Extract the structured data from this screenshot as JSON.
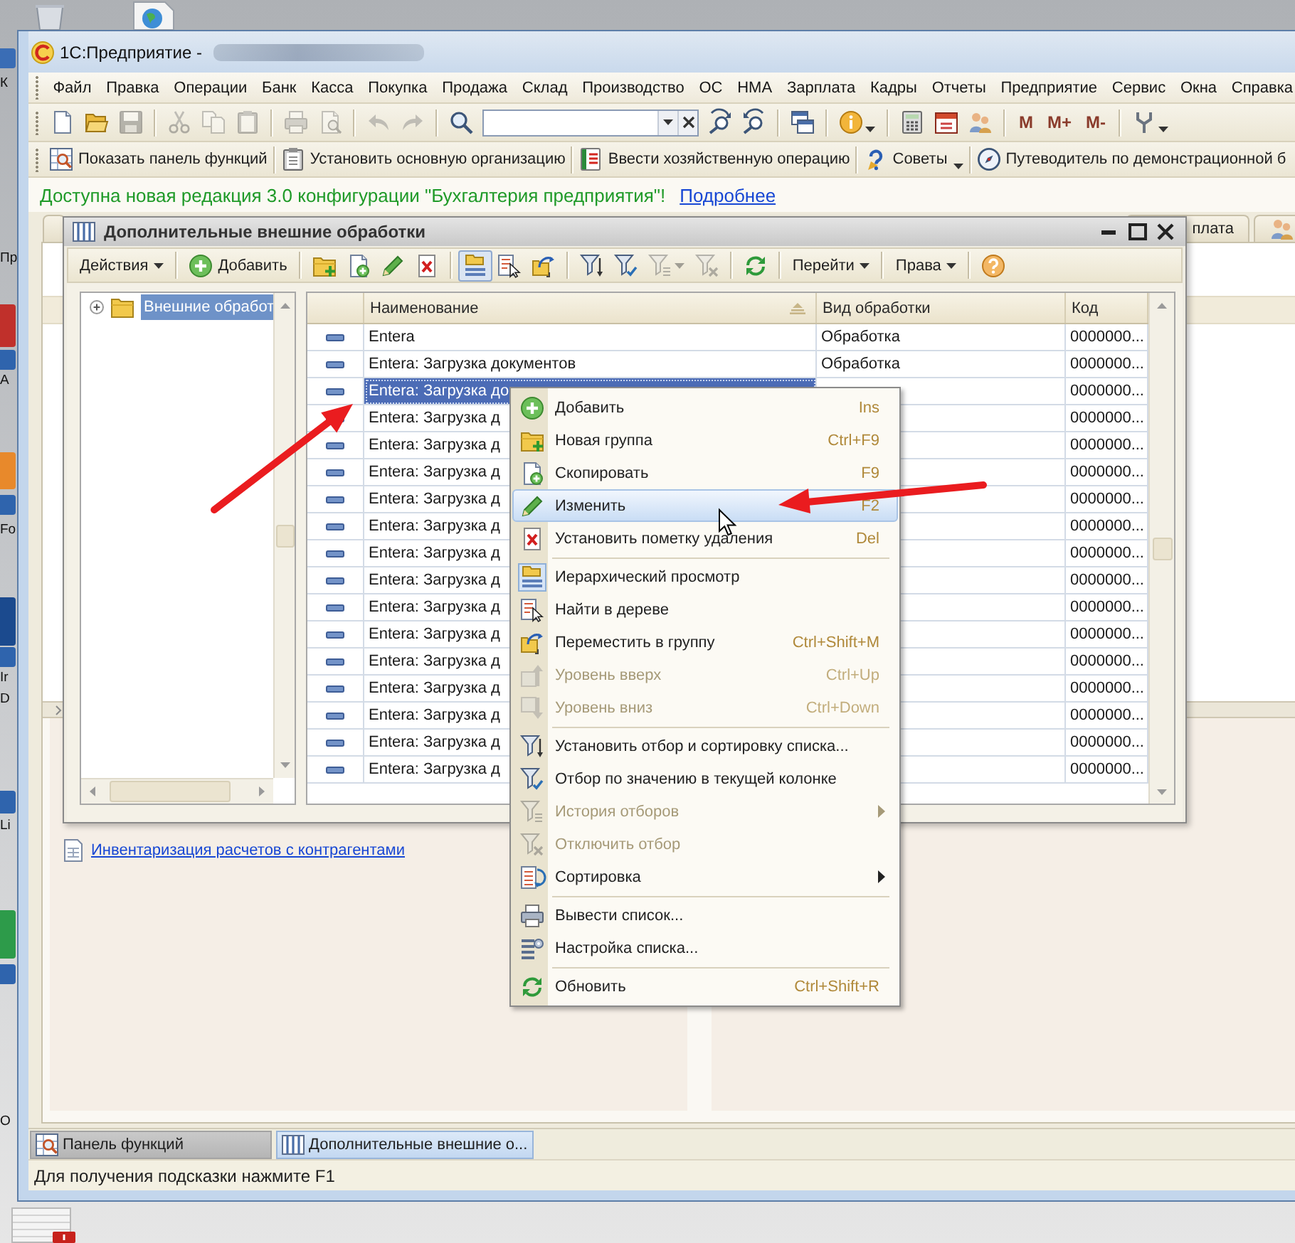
{
  "desktop": {
    "icon_labels": [
      "К",
      "Пр",
      "А",
      "Fo",
      "Ir",
      "D",
      "Li",
      "O"
    ]
  },
  "window": {
    "title": "1С:Предприятие -"
  },
  "menu_bar": [
    "Файл",
    "Правка",
    "Операции",
    "Банк",
    "Касса",
    "Покупка",
    "Продажа",
    "Склад",
    "Производство",
    "ОС",
    "НМА",
    "Зарплата",
    "Кадры",
    "Отчеты",
    "Предприятие",
    "Сервис",
    "Окна",
    "Справка"
  ],
  "toolbar": [
    [
      {
        "kind": "icon",
        "disabled": false,
        "has_menu": false
      },
      {
        "kind": "icon",
        "disabled": false,
        "has_menu": false
      },
      {
        "kind": "icon",
        "disabled": true,
        "has_menu": false
      }
    ],
    [
      {
        "kind": "icon",
        "disabled": true,
        "has_menu": false
      },
      {
        "kind": "icon",
        "disabled": true,
        "has_menu": false
      },
      {
        "kind": "icon",
        "disabled": true,
        "has_menu": false
      }
    ],
    [
      {
        "kind": "icon",
        "disabled": true,
        "has_menu": false
      },
      {
        "kind": "icon",
        "disabled": true,
        "has_menu": false
      }
    ],
    [
      {
        "kind": "icon",
        "disabled": true,
        "has_menu": false
      },
      {
        "kind": "icon",
        "disabled": true,
        "has_menu": false
      }
    ],
    [
      {
        "kind": "icon",
        "disabled": false,
        "has_menu": false
      },
      {
        "kind": "search_field",
        "disabled": false,
        "has_menu": true
      },
      {
        "kind": "icon",
        "disabled": false,
        "has_menu": false
      },
      {
        "kind": "icon",
        "disabled": false,
        "has_menu": false
      }
    ],
    [
      {
        "kind": "icon",
        "disabled": false,
        "has_menu": false
      }
    ],
    [
      {
        "kind": "icon",
        "disabled": false,
        "has_menu": true
      }
    ],
    [
      {
        "kind": "icon",
        "disabled": false,
        "has_menu": false
      },
      {
        "kind": "icon",
        "disabled": false,
        "has_menu": false
      },
      {
        "kind": "icon",
        "disabled": false,
        "has_menu": false
      }
    ],
    [
      {
        "kind": "text",
        "label": "M",
        "disabled": false,
        "has_menu": false
      },
      {
        "kind": "text",
        "label": "M+",
        "disabled": false,
        "has_menu": false
      },
      {
        "kind": "text",
        "label": "M-",
        "disabled": false,
        "has_menu": false
      }
    ],
    [
      {
        "kind": "icon",
        "disabled": false,
        "has_menu": true
      }
    ]
  ],
  "toolbar_2": [
    {
      "label": "Показать панель функций",
      "has_menu": false
    },
    {
      "label": "Установить основную организацию",
      "has_menu": false
    },
    {
      "label": "Ввести хозяйственную операцию",
      "has_menu": false
    },
    {
      "label": "Советы",
      "has_menu": true
    },
    {
      "label": "Путеводитель по демонстрационной б",
      "has_menu": false
    }
  ],
  "notice": {
    "text": "Доступна новая редакция 3.0 конфигурации \"Бухгалтерия предприятия\"!",
    "link": "Подробнее"
  },
  "workspace": {
    "tabs": [
      {
        "kind": "text",
        "label": "плата"
      },
      {
        "kind": "icon"
      }
    ],
    "links": [
      "Инвентаризация расчетов с контрагентами"
    ]
  },
  "dialog": {
    "title": "Дополнительные внешние обработки",
    "toolbar": [
      [
        {
          "kind": "menu",
          "label": "Действия",
          "pressed": false,
          "disabled": false,
          "has_menu": true
        }
      ],
      [
        {
          "kind": "button",
          "label": "Добавить",
          "pressed": false,
          "disabled": false,
          "has_menu": false
        }
      ],
      [
        {
          "kind": "icon",
          "pressed": false,
          "disabled": false,
          "has_menu": false
        },
        {
          "kind": "icon",
          "pressed": false,
          "disabled": false,
          "has_menu": false
        },
        {
          "kind": "icon",
          "pressed": false,
          "disabled": false,
          "has_menu": false
        },
        {
          "kind": "icon",
          "pressed": false,
          "disabled": false,
          "has_menu": false
        }
      ],
      [
        {
          "kind": "icon",
          "pressed": true,
          "disabled": false,
          "has_menu": false
        },
        {
          "kind": "icon",
          "pressed": false,
          "disabled": false,
          "has_menu": false
        },
        {
          "kind": "icon",
          "pressed": false,
          "disabled": false,
          "has_menu": false
        }
      ],
      [
        {
          "kind": "icon",
          "pressed": false,
          "disabled": false,
          "has_menu": false
        },
        {
          "kind": "icon",
          "pressed": false,
          "disabled": false,
          "has_menu": false
        },
        {
          "kind": "icon",
          "pressed": false,
          "disabled": true,
          "has_menu": true
        },
        {
          "kind": "icon",
          "pressed": false,
          "disabled": true,
          "has_menu": false
        }
      ],
      [
        {
          "kind": "icon",
          "pressed": false,
          "disabled": false,
          "has_menu": false
        }
      ],
      [
        {
          "kind": "menu",
          "label": "Перейти",
          "pressed": false,
          "disabled": false,
          "has_menu": true
        }
      ],
      [
        {
          "kind": "menu",
          "label": "Права",
          "pressed": false,
          "disabled": false,
          "has_menu": true
        }
      ],
      [
        {
          "kind": "icon",
          "pressed": false,
          "disabled": false,
          "has_menu": false
        }
      ]
    ],
    "tree": [
      {
        "label": "Внешние обработ",
        "selected": true,
        "expanded": false
      }
    ],
    "table": {
      "columns": [
        {
          "label": "Наименование",
          "sorted": true
        },
        {
          "label": "Вид обработки",
          "sorted": false
        },
        {
          "label": "Код",
          "sorted": false
        }
      ],
      "rows": [
        {
          "name": "Entera",
          "type": "Обработка",
          "code": "0000000...",
          "selected": false
        },
        {
          "name": "Entera: Загрузка документов",
          "type": "Обработка",
          "code": "0000000...",
          "selected": false
        },
        {
          "name": "Entera: Загрузка до",
          "code": "0000000...",
          "selected": true
        },
        {
          "name": "Entera: Загрузка д",
          "code": "0000000...",
          "selected": false
        },
        {
          "name": "Entera: Загрузка д",
          "code": "0000000...",
          "selected": false
        },
        {
          "name": "Entera: Загрузка д",
          "code": "0000000...",
          "selected": false
        },
        {
          "name": "Entera: Загрузка д",
          "code": "0000000...",
          "selected": false
        },
        {
          "name": "Entera: Загрузка д",
          "code": "0000000...",
          "selected": false
        },
        {
          "name": "Entera: Загрузка д",
          "code": "0000000...",
          "selected": false
        },
        {
          "name": "Entera: Загрузка д",
          "code": "0000000...",
          "selected": false
        },
        {
          "name": "Entera: Загрузка д",
          "code": "0000000...",
          "selected": false
        },
        {
          "name": "Entera: Загрузка д",
          "code": "0000000...",
          "selected": false
        },
        {
          "name": "Entera: Загрузка д",
          "code": "0000000...",
          "selected": false
        },
        {
          "name": "Entera: Загрузка д",
          "code": "0000000...",
          "selected": false
        },
        {
          "name": "Entera: Загрузка д",
          "code": "0000000...",
          "selected": false
        },
        {
          "name": "Entera: Загрузка д",
          "code": "0000000...",
          "selected": false
        },
        {
          "name": "Entera: Загрузка д",
          "code": "0000000...",
          "selected": false
        }
      ]
    }
  },
  "context_menu": {
    "groups": [
      [
        {
          "label": "Добавить",
          "shortcut": "Ins",
          "disabled": false,
          "selected": false,
          "checked": false,
          "submenu": false
        },
        {
          "label": "Новая группа",
          "shortcut": "Ctrl+F9",
          "disabled": false,
          "selected": false,
          "checked": false,
          "submenu": false
        },
        {
          "label": "Скопировать",
          "shortcut": "F9",
          "disabled": false,
          "selected": false,
          "checked": false,
          "submenu": false
        },
        {
          "label": "Изменить",
          "shortcut": "F2",
          "disabled": false,
          "selected": true,
          "checked": false,
          "submenu": false
        },
        {
          "label": "Установить пометку удаления",
          "shortcut": "Del",
          "disabled": false,
          "selected": false,
          "checked": false,
          "submenu": false
        }
      ],
      [
        {
          "label": "Иерархический просмотр",
          "disabled": false,
          "selected": false,
          "checked": true,
          "submenu": false
        },
        {
          "label": "Найти в дереве",
          "disabled": false,
          "selected": false,
          "checked": false,
          "submenu": false
        },
        {
          "label": "Переместить в группу",
          "shortcut": "Ctrl+Shift+M",
          "disabled": false,
          "selected": false,
          "checked": false,
          "submenu": false
        },
        {
          "label": "Уровень вверх",
          "shortcut": "Ctrl+Up",
          "disabled": true,
          "selected": false,
          "checked": false,
          "submenu": false
        },
        {
          "label": "Уровень вниз",
          "shortcut": "Ctrl+Down",
          "disabled": true,
          "selected": false,
          "checked": false,
          "submenu": false
        }
      ],
      [
        {
          "label": "Установить отбор и сортировку списка...",
          "disabled": false,
          "selected": false,
          "checked": false,
          "submenu": false
        },
        {
          "label": "Отбор по значению в текущей колонке",
          "disabled": false,
          "selected": false,
          "checked": false,
          "submenu": false
        },
        {
          "label": "История отборов",
          "disabled": true,
          "selected": false,
          "checked": false,
          "submenu": true
        },
        {
          "label": "Отключить отбор",
          "disabled": true,
          "selected": false,
          "checked": false,
          "submenu": false
        },
        {
          "label": "Сортировка",
          "disabled": false,
          "selected": false,
          "checked": false,
          "submenu": true
        }
      ],
      [
        {
          "label": "Вывести список...",
          "disabled": false,
          "selected": false,
          "checked": false,
          "submenu": false
        },
        {
          "label": "Настройка списка...",
          "disabled": false,
          "selected": false,
          "checked": false,
          "submenu": false
        }
      ],
      [
        {
          "label": "Обновить",
          "shortcut": "Ctrl+Shift+R",
          "disabled": false,
          "selected": false,
          "checked": false,
          "submenu": false
        }
      ]
    ]
  },
  "window_tabs": [
    {
      "label": "Панель функций",
      "selected": false
    },
    {
      "label": "Дополнительные внешние о...",
      "selected": true
    }
  ],
  "status_bar": {
    "text": "Для получения подсказки нажмите F1"
  }
}
